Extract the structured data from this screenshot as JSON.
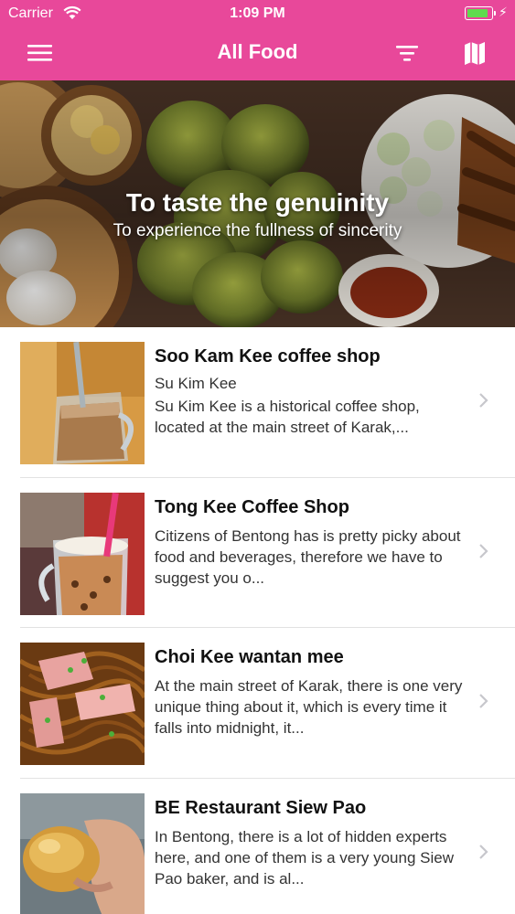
{
  "status_bar": {
    "carrier": "Carrier",
    "time": "1:09 PM",
    "battery_level": 0.9
  },
  "nav": {
    "title": "All Food",
    "left_icon": "hamburger-menu-icon",
    "right_icons": [
      "filter-icon",
      "map-icon"
    ]
  },
  "hero": {
    "title": "To taste the genuinity",
    "subtitle": "To experience the fullness of sincerity"
  },
  "list": [
    {
      "title": "Soo Kam Kee coffee shop",
      "subtitle": "Su Kim Kee",
      "description": "Su Kim Kee is a historical coffee shop, located at the main street of Karak,..."
    },
    {
      "title": "Tong Kee Coffee Shop",
      "description": "Citizens of Bentong has is pretty picky about food and beverages, therefore we have to suggest you o..."
    },
    {
      "title": "Choi Kee wantan mee",
      "description": "At the main street of Karak, there is one very unique thing about it, which is every time it falls into midnight, it..."
    },
    {
      "title": "BE Restaurant Siew Pao",
      "description": "In Bentong, there is a lot of hidden experts here, and one of them is a very young Siew Pao baker, and is al..."
    }
  ],
  "colors": {
    "brand": "#e8489a",
    "battery": "#5fdc4e",
    "separator": "#e2e2e2"
  }
}
